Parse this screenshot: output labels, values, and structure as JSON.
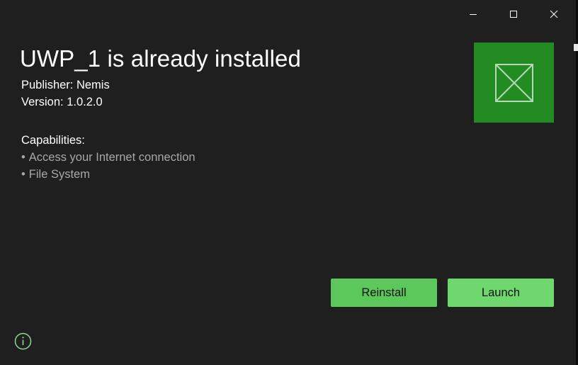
{
  "window": {
    "caption_buttons": {
      "minimize_icon": "minimize-icon",
      "maximize_icon": "maximize-icon",
      "close_icon": "close-icon"
    }
  },
  "app": {
    "title": "UWP_1 is already installed",
    "publisher": "Publisher: Nemis",
    "version": "Version: 1.0.2.0",
    "logo_icon": "placeholder-image-icon",
    "logo_color": "#228b22"
  },
  "capabilities": {
    "heading": "Capabilities:",
    "bullet": "•",
    "items": [
      "Access your Internet connection",
      "File System"
    ]
  },
  "actions": {
    "reinstall_label": "Reinstall",
    "launch_label": "Launch",
    "reinstall_color": "#5cc85c",
    "launch_color": "#6ed86e"
  },
  "footer": {
    "info_icon": "info-icon",
    "info_color": "#8fd88f"
  },
  "theme": {
    "background": "#1f1f1f",
    "text_primary": "#ffffff",
    "text_secondary": "#a8a8a8"
  }
}
